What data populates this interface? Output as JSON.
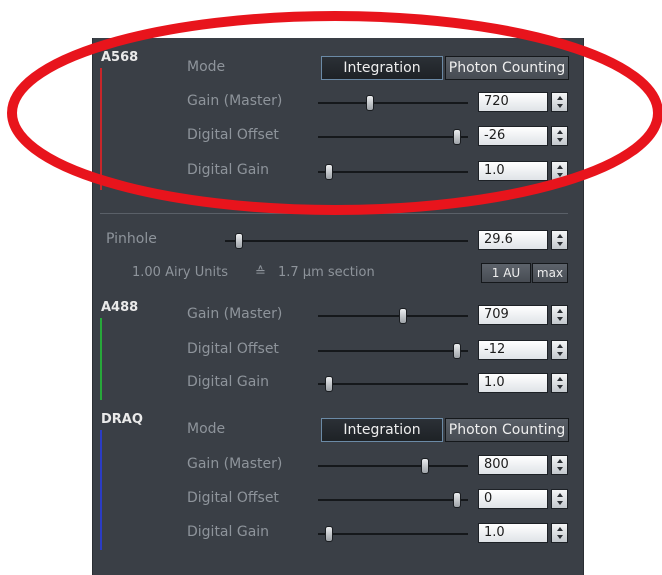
{
  "colors": {
    "panel_bg": "#3a3f46",
    "highlight_ring": "#e8141c",
    "channel_a568": "#c8262a",
    "channel_a488": "#27a83a",
    "channel_draq": "#2b3cc4"
  },
  "channels": [
    {
      "name": "A568",
      "mode": {
        "label": "Mode",
        "options": [
          "Integration",
          "Photon Counting"
        ],
        "selected": "Integration"
      },
      "gain_master": {
        "label": "Gain (Master)",
        "value": "720"
      },
      "digital_offset": {
        "label": "Digital Offset",
        "value": "-26"
      },
      "digital_gain": {
        "label": "Digital Gain",
        "value": "1.0"
      }
    },
    {
      "name": "A488",
      "gain_master": {
        "label": "Gain (Master)",
        "value": "709"
      },
      "digital_offset": {
        "label": "Digital Offset",
        "value": "-12"
      },
      "digital_gain": {
        "label": "Digital Gain",
        "value": "1.0"
      }
    },
    {
      "name": "DRAQ",
      "mode": {
        "label": "Mode",
        "options": [
          "Integration",
          "Photon Counting"
        ],
        "selected": "Integration"
      },
      "gain_master": {
        "label": "Gain (Master)",
        "value": "800"
      },
      "digital_offset": {
        "label": "Digital Offset",
        "value": "0"
      },
      "digital_gain": {
        "label": "Digital Gain",
        "value": "1.0"
      }
    }
  ],
  "pinhole": {
    "label": "Pinhole",
    "value": "29.6",
    "airy_units": "1.00 Airy Units",
    "approx_symbol": "≙",
    "section": "1.7 µm section",
    "au_button": "1 AU",
    "max_button": "max"
  }
}
